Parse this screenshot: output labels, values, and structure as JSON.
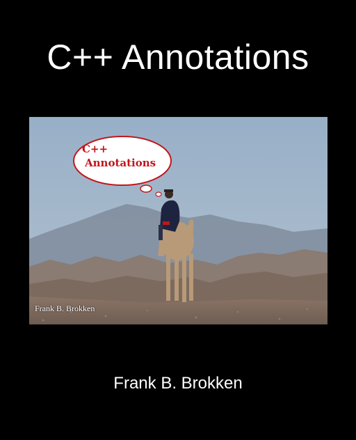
{
  "cover": {
    "title": "C++ Annotations",
    "author": "Frank B. Brokken"
  },
  "photo": {
    "bubble_line1": "C++",
    "bubble_line2": "Annotations",
    "credit": "Frank B. Brokken"
  },
  "colors": {
    "background": "#000000",
    "bubble_text": "#c0161b",
    "sky": "#9ab0c6"
  }
}
